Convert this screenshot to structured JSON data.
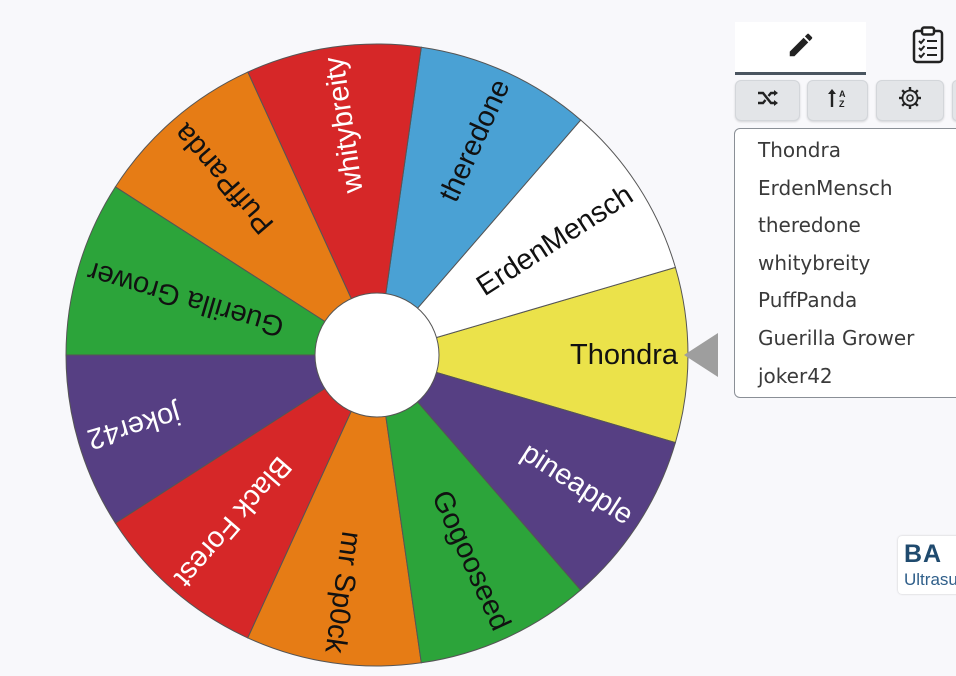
{
  "wheel": {
    "segments": [
      {
        "label": "Thondra",
        "color": "#ebe24a",
        "text_color": "#111111"
      },
      {
        "label": "ErdenMensch",
        "color": "#ffffff",
        "text_color": "#111111"
      },
      {
        "label": "theredone",
        "color": "#4aa1d4",
        "text_color": "#111111"
      },
      {
        "label": "whitybreity",
        "color": "#d62728",
        "text_color": "#ffffff"
      },
      {
        "label": "PuffPanda",
        "color": "#e67c15",
        "text_color": "#111111"
      },
      {
        "label": "Guerilla Grower",
        "color": "#2ca43a",
        "text_color": "#111111"
      },
      {
        "label": "joker42",
        "color": "#563f83",
        "text_color": "#ffffff"
      },
      {
        "label": "Black Forest",
        "color": "#d62728",
        "text_color": "#ffffff"
      },
      {
        "label": "mr Sp0ck",
        "color": "#e67c15",
        "text_color": "#111111"
      },
      {
        "label": "Gogooseed",
        "color": "#2ca43a",
        "text_color": "#111111"
      },
      {
        "label": "pineapple",
        "color": "#563f83",
        "text_color": "#ffffff"
      }
    ],
    "pointer_color": "#9e9e9e"
  },
  "tabs": [
    {
      "name": "tab-edit-entries",
      "icon": "pencil-icon",
      "active": true
    },
    {
      "name": "tab-results",
      "icon": "clipboard-checklist-icon",
      "active": false
    }
  ],
  "toolbar": [
    {
      "name": "shuffle-button",
      "icon": "shuffle-icon"
    },
    {
      "name": "sort-button",
      "icon": "sort-az-icon"
    },
    {
      "name": "settings-button",
      "icon": "gear-icon"
    }
  ],
  "entries": [
    "Thondra",
    "ErdenMensch",
    "theredone",
    "whitybreity",
    "PuffPanda",
    "Guerilla Grower",
    "joker42"
  ],
  "ad": {
    "brand": "BA",
    "subtitle": "Ultrasu"
  }
}
